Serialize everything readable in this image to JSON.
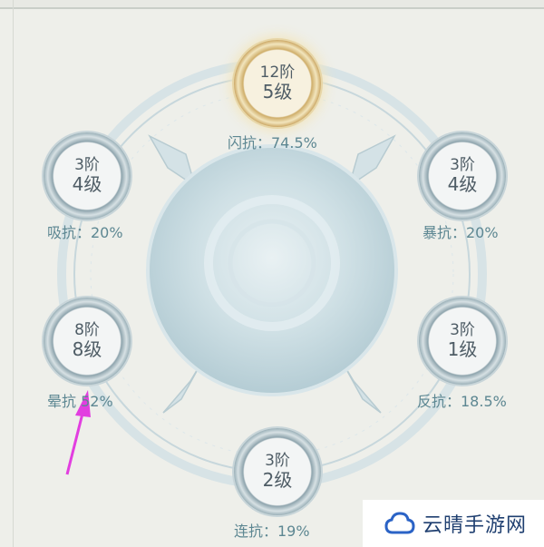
{
  "nodes": [
    {
      "id": "flash",
      "stage": "12阶",
      "level": "5级",
      "label": "闪抗：74.5%",
      "highlight": true
    },
    {
      "id": "absorb",
      "stage": "3阶",
      "level": "4级",
      "label": "吸抗：20%",
      "highlight": false
    },
    {
      "id": "crit",
      "stage": "3阶",
      "level": "4级",
      "label": "暴抗：20%",
      "highlight": false
    },
    {
      "id": "stun",
      "stage": "8阶",
      "level": "8级",
      "label": "晕抗  52%",
      "highlight": false
    },
    {
      "id": "counter",
      "stage": "3阶",
      "level": "1级",
      "label": "反抗：18.5%",
      "highlight": false
    },
    {
      "id": "combo",
      "stage": "3阶",
      "level": "2级",
      "label": "连抗：19%",
      "highlight": false
    }
  ],
  "watermark": {
    "text": "云晴手游网",
    "icon": "cloud-icon"
  },
  "colors": {
    "accent_label": "#5d8792",
    "arrow": "#e23ee0",
    "gold": "#cfae6a"
  }
}
